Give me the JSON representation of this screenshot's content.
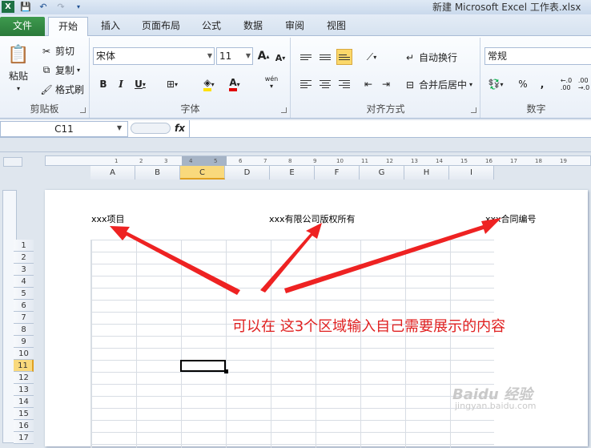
{
  "window": {
    "title": "新建 Microsoft Excel 工作表.xlsx"
  },
  "tabs": [
    "文件",
    "开始",
    "插入",
    "页面布局",
    "公式",
    "数据",
    "审阅",
    "视图"
  ],
  "clipboard": {
    "paste": "粘贴",
    "cut": "剪切",
    "copy": "复制",
    "format_painter": "格式刷",
    "group": "剪贴板"
  },
  "font": {
    "name": "宋体",
    "size": "11",
    "group": "字体",
    "bold": "B",
    "italic": "I",
    "underline": "U",
    "grow": "A",
    "shrink": "A"
  },
  "alignment": {
    "wrap": "自动换行",
    "merge": "合并后居中",
    "group": "对齐方式"
  },
  "number": {
    "format": "常规",
    "group": "数字",
    "percent": "%",
    "comma": ","
  },
  "formula_bar": {
    "cell_ref": "C11",
    "fx": "fx"
  },
  "columns": [
    "A",
    "B",
    "C",
    "D",
    "E",
    "F",
    "G",
    "H",
    "I"
  ],
  "selected_column": "C",
  "rows": [
    "1",
    "2",
    "3",
    "4",
    "5",
    "6",
    "7",
    "8",
    "9",
    "10",
    "11",
    "12",
    "13",
    "14",
    "15",
    "16",
    "17"
  ],
  "selected_row": "11",
  "ruler_ticks": [
    "1",
    "2",
    "3",
    "4",
    "5",
    "6",
    "7",
    "8",
    "9",
    "10",
    "11",
    "12",
    "13",
    "14",
    "15",
    "16",
    "17",
    "18",
    "19"
  ],
  "header": {
    "left": "xxx项目",
    "center": "xxx有限公司版权所有",
    "right": "xxx合同编号"
  },
  "annotation": "可以在 这3个区域输入自己需要展示的内容",
  "watermark": {
    "main": "Baidu 经验",
    "sub": "jingyan.baidu.com"
  },
  "colors": {
    "accent": "#2a7a3a",
    "annotation": "#e02020",
    "selection": "#f9d97c"
  }
}
